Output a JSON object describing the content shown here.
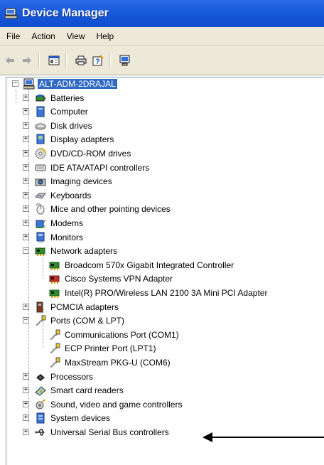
{
  "window": {
    "title": "Device Manager"
  },
  "menu": [
    "File",
    "Action",
    "View",
    "Help"
  ],
  "toolbar": {
    "buttons": [
      "back-icon",
      "forward-icon",
      "properties-icon",
      "print-icon",
      "help-icon",
      "scan-hardware-icon"
    ]
  },
  "tree": {
    "root": "ALT-ADM-2DRAJAL",
    "categories": [
      {
        "label": "Batteries",
        "expanded": false,
        "icon": "battery-icon"
      },
      {
        "label": "Computer",
        "expanded": false,
        "icon": "computer-icon"
      },
      {
        "label": "Disk drives",
        "expanded": false,
        "icon": "disk-icon"
      },
      {
        "label": "Display adapters",
        "expanded": false,
        "icon": "display-icon"
      },
      {
        "label": "DVD/CD-ROM drives",
        "expanded": false,
        "icon": "cdrom-icon"
      },
      {
        "label": "IDE ATA/ATAPI controllers",
        "expanded": false,
        "icon": "ide-icon"
      },
      {
        "label": "Imaging devices",
        "expanded": false,
        "icon": "camera-icon"
      },
      {
        "label": "Keyboards",
        "expanded": false,
        "icon": "keyboard-icon"
      },
      {
        "label": "Mice and other pointing devices",
        "expanded": false,
        "icon": "mouse-icon"
      },
      {
        "label": "Modems",
        "expanded": false,
        "icon": "modem-icon"
      },
      {
        "label": "Monitors",
        "expanded": false,
        "icon": "monitor-icon"
      },
      {
        "label": "Network adapters",
        "expanded": true,
        "icon": "network-icon",
        "children": [
          "Broadcom 570x Gigabit Integrated Controller",
          "Cisco Systems VPN Adapter",
          "Intel(R) PRO/Wireless LAN 2100 3A Mini PCI Adapter"
        ]
      },
      {
        "label": "PCMCIA adapters",
        "expanded": false,
        "icon": "pcmcia-icon"
      },
      {
        "label": "Ports (COM & LPT)",
        "expanded": true,
        "icon": "port-icon",
        "children": [
          "Communications Port (COM1)",
          "ECP Printer Port (LPT1)",
          "MaxStream PKG-U (COM6)"
        ]
      },
      {
        "label": "Processors",
        "expanded": false,
        "icon": "cpu-icon"
      },
      {
        "label": "Smart card readers",
        "expanded": false,
        "icon": "smartcard-icon"
      },
      {
        "label": "Sound, video and game controllers",
        "expanded": false,
        "icon": "sound-icon"
      },
      {
        "label": "System devices",
        "expanded": false,
        "icon": "system-icon"
      },
      {
        "label": "Universal Serial Bus controllers",
        "expanded": false,
        "icon": "usb-icon"
      }
    ]
  },
  "colors": {
    "titlebar": "#1657d8",
    "selection": "#316ac5",
    "chrome": "#ece9d8"
  }
}
